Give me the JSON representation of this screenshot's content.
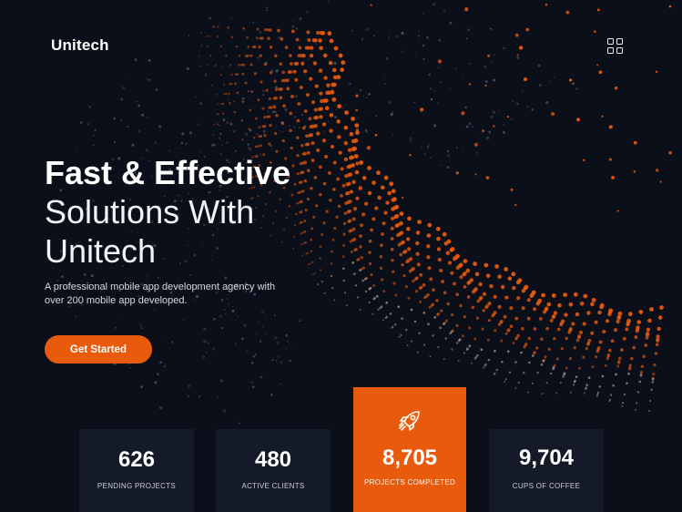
{
  "brand": {
    "name": "Unitech"
  },
  "header": {
    "menu_icon": "grid-menu-icon"
  },
  "hero": {
    "headline_bold": "Fast & Effective",
    "headline_line2": "Solutions With",
    "headline_line3": "Unitech",
    "description": "A professional mobile app development agency with over 200 mobile app developed.",
    "cta_label": "Get Started"
  },
  "stats": [
    {
      "value": "626",
      "label": "PENDING PROJECTS"
    },
    {
      "value": "480",
      "label": "ACTIVE CLIENTS"
    },
    {
      "value": "8,705",
      "label": "PROJECTS COMPLETED",
      "icon": "rocket-icon"
    },
    {
      "value": "9,704",
      "label": "CUPS OF COFFEE"
    }
  ],
  "colors": {
    "accent": "#e85a0c",
    "background": "#0b0f1a",
    "card": "#141a27"
  }
}
